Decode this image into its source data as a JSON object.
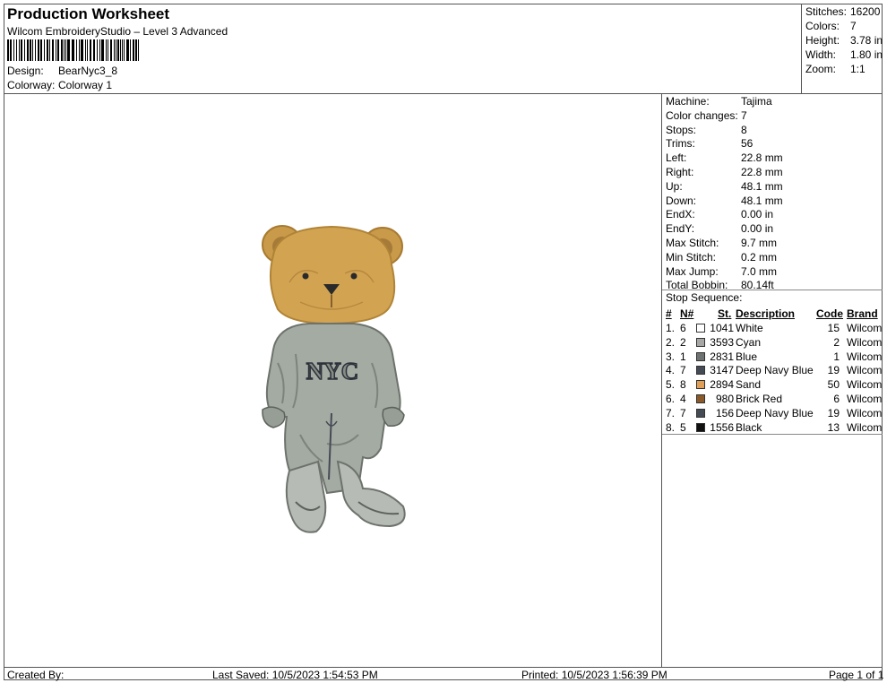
{
  "header": {
    "title": "Production Worksheet",
    "subtitle": "Wilcom EmbroideryStudio – Level 3 Advanced",
    "design_label": "Design:",
    "design_value": "BearNyc3_8",
    "colorway_label": "Colorway:",
    "colorway_value": "Colorway 1"
  },
  "stats": {
    "stitches_label": "Stitches:",
    "stitches_value": "16200",
    "colors_label": "Colors:",
    "colors_value": "7",
    "height_label": "Height:",
    "height_value": "3.78 in",
    "width_label": "Width:",
    "width_value": "1.80 in",
    "zoom_label": "Zoom:",
    "zoom_value": "1:1"
  },
  "machine": [
    {
      "label": "Machine:",
      "value": "Tajima"
    },
    {
      "label": "Color changes:",
      "value": "7"
    },
    {
      "label": "Stops:",
      "value": "8"
    },
    {
      "label": "Trims:",
      "value": "56"
    },
    {
      "label": "Left:",
      "value": "22.8 mm"
    },
    {
      "label": "Right:",
      "value": "22.8 mm"
    },
    {
      "label": "Up:",
      "value": "48.1 mm"
    },
    {
      "label": "Down:",
      "value": "48.1 mm"
    },
    {
      "label": "EndX:",
      "value": "0.00 in"
    },
    {
      "label": "EndY:",
      "value": "0.00 in"
    },
    {
      "label": "Max Stitch:",
      "value": "9.7 mm"
    },
    {
      "label": "Min Stitch:",
      "value": "0.2 mm"
    },
    {
      "label": "Max Jump:",
      "value": "7.0 mm"
    },
    {
      "label": "Total Bobbin:",
      "value": "80.14ft"
    }
  ],
  "stop_sequence": {
    "title": "Stop Sequence:",
    "headers": {
      "num": "#",
      "n": "N#",
      "st": "St.",
      "desc": "Description",
      "code": "Code",
      "brand": "Brand"
    },
    "rows": [
      {
        "num": "1.",
        "n": "6",
        "color": "#ffffff",
        "st": "1041",
        "desc": "White",
        "code": "15",
        "brand": "Wilcom"
      },
      {
        "num": "2.",
        "n": "2",
        "color": "#a7a8a6",
        "st": "3593",
        "desc": "Cyan",
        "code": "2",
        "brand": "Wilcom"
      },
      {
        "num": "3.",
        "n": "1",
        "color": "#6e7270",
        "st": "2831",
        "desc": "Blue",
        "code": "1",
        "brand": "Wilcom"
      },
      {
        "num": "4.",
        "n": "7",
        "color": "#454b55",
        "st": "3147",
        "desc": "Deep Navy Blue",
        "code": "19",
        "brand": "Wilcom"
      },
      {
        "num": "5.",
        "n": "8",
        "color": "#e0a058",
        "st": "2894",
        "desc": "Sand",
        "code": "50",
        "brand": "Wilcom"
      },
      {
        "num": "6.",
        "n": "4",
        "color": "#8a5a2a",
        "st": "980",
        "desc": "Brick Red",
        "code": "6",
        "brand": "Wilcom"
      },
      {
        "num": "7.",
        "n": "7",
        "color": "#454b55",
        "st": "156",
        "desc": "Deep Navy Blue",
        "code": "19",
        "brand": "Wilcom"
      },
      {
        "num": "8.",
        "n": "5",
        "color": "#111111",
        "st": "1556",
        "desc": "Black",
        "code": "13",
        "brand": "Wilcom"
      }
    ]
  },
  "design": {
    "shirt_text": "NYC"
  },
  "footer": {
    "created_by": "Created By:",
    "last_saved": "Last Saved: 10/5/2023 1:54:53 PM",
    "printed": "Printed: 10/5/2023 1:56:39 PM",
    "page": "Page 1 of 1"
  }
}
